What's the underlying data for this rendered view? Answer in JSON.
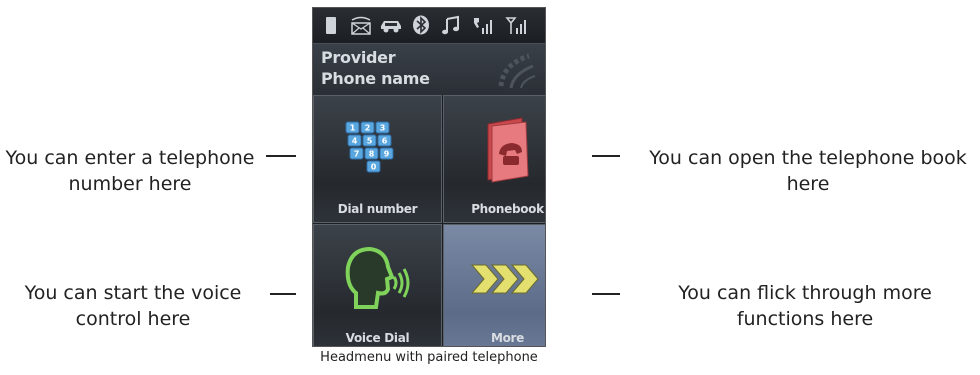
{
  "status_icons": [
    "battery-icon",
    "message-icon",
    "car-icon",
    "bluetooth-icon",
    "music-icon",
    "phone-signal-icon",
    "antenna-signal-icon"
  ],
  "info": {
    "provider": "Provider",
    "phone_name": "Phone name"
  },
  "tiles": {
    "dial": {
      "label": "Dial number",
      "icon": "keypad-icon"
    },
    "phonebook": {
      "label": "Phonebook",
      "icon": "phonebook-icon"
    },
    "voice": {
      "label": "Voice Dial",
      "icon": "voice-head-icon"
    },
    "more": {
      "label": "More",
      "icon": "chevrons-icon"
    }
  },
  "annotations": {
    "dial": "You can enter a telephone number here",
    "phonebook": "You can open the telephone book here",
    "voice": "You can start the voice control here",
    "more": "You can flick through more functions here"
  },
  "caption": "Headmenu with paired telephone",
  "colors": {
    "screen_bg": "#1b1e22",
    "tile_dark": "#2e3339",
    "tile_selected": "#6a7a96",
    "keypad_blue": "#5aa7e0",
    "phonebook_red": "#c8484c",
    "voice_green": "#7fd25a",
    "chevron_yellow": "#e4e070"
  }
}
